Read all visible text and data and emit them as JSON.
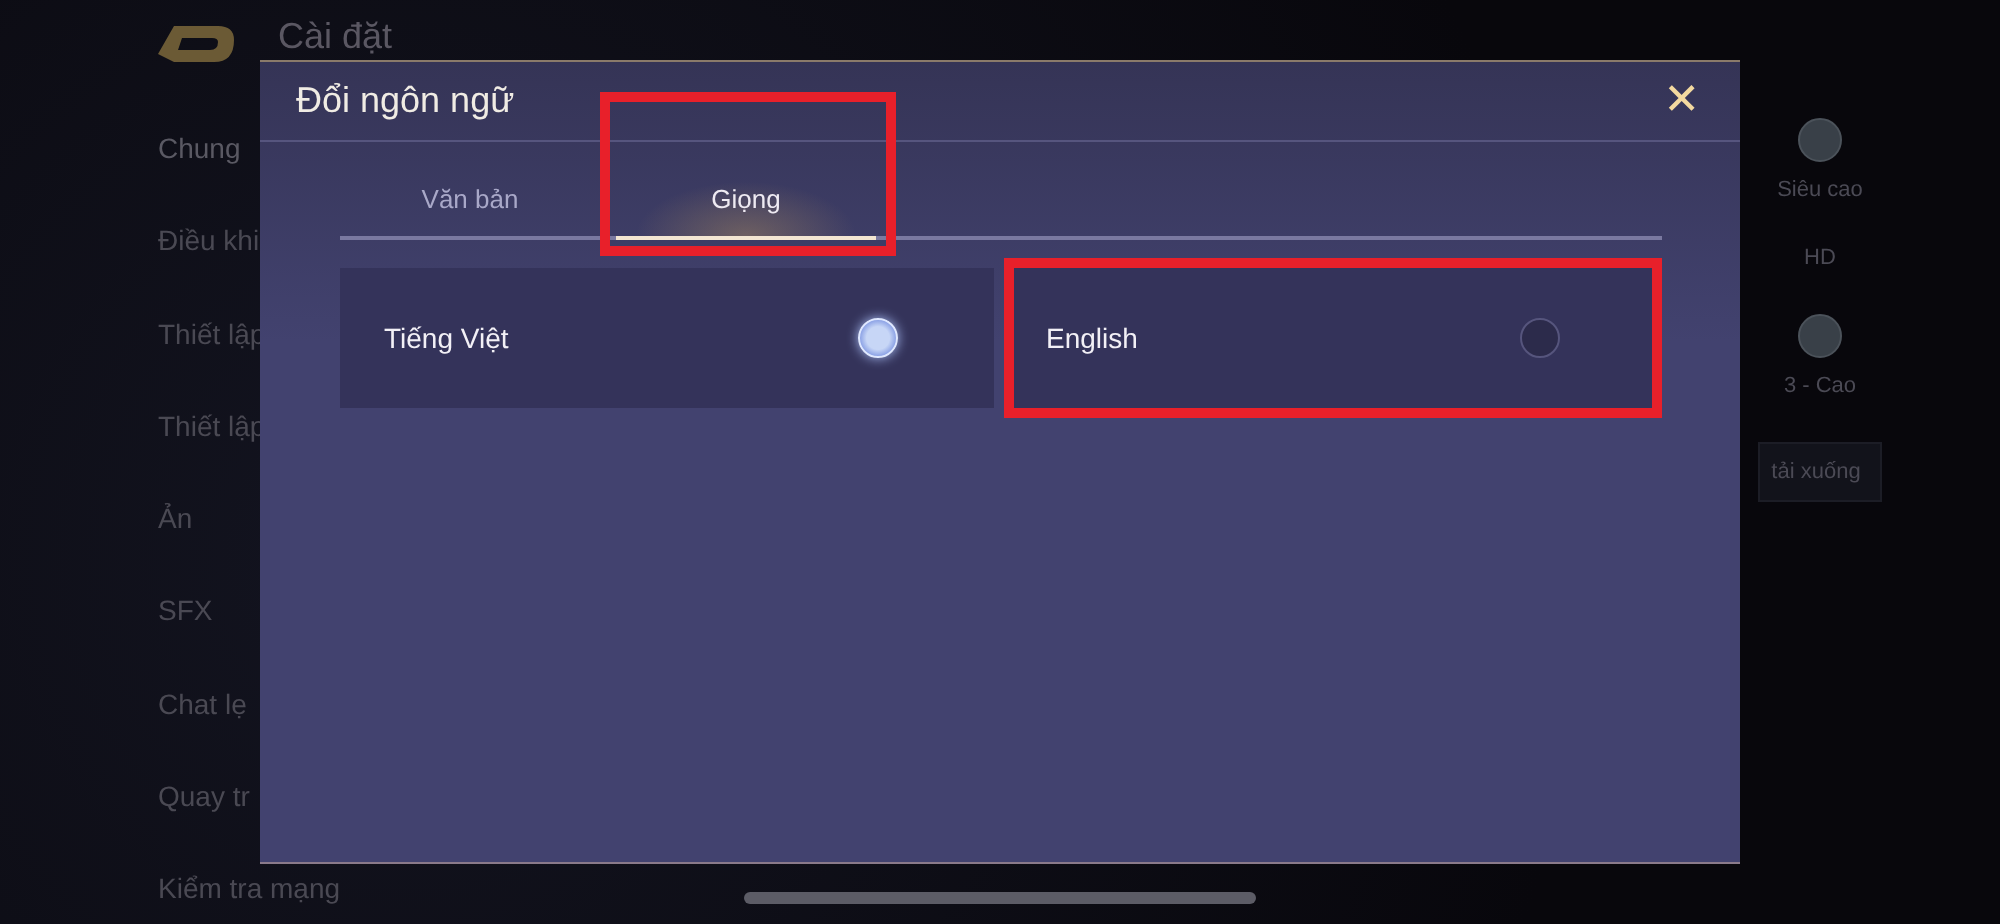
{
  "background": {
    "title": "Cài đặt",
    "sidebar": {
      "items": [
        {
          "label": "Chung",
          "selected": true
        },
        {
          "label": "Điều khi",
          "selected": false
        },
        {
          "label": "Thiết lập",
          "selected": false
        },
        {
          "label": "Thiết lập",
          "selected": false
        },
        {
          "label": "Ản",
          "selected": false
        },
        {
          "label": "SFX",
          "selected": false
        },
        {
          "label": "Chat lẹ",
          "selected": false
        },
        {
          "label": "Quay tr",
          "selected": false
        },
        {
          "label": "Kiểm tra mạng",
          "selected": false
        }
      ]
    },
    "settings": [
      {
        "kind": "slider",
        "label": "Siêu cao"
      },
      {
        "kind": "text",
        "label": "HD"
      },
      {
        "kind": "slider",
        "label": "3 - Cao"
      },
      {
        "kind": "button",
        "label": "tải xuống"
      }
    ]
  },
  "dialog": {
    "title": "Đổi ngôn ngữ",
    "close": "✕",
    "tabs": [
      {
        "label": "Văn bản",
        "selected": false,
        "highlighted": false
      },
      {
        "label": "Giọng",
        "selected": true,
        "highlighted": true
      }
    ],
    "options": [
      {
        "label": "Tiếng Việt",
        "selected": true,
        "highlighted": false
      },
      {
        "label": "English",
        "selected": false,
        "highlighted": true
      }
    ]
  }
}
